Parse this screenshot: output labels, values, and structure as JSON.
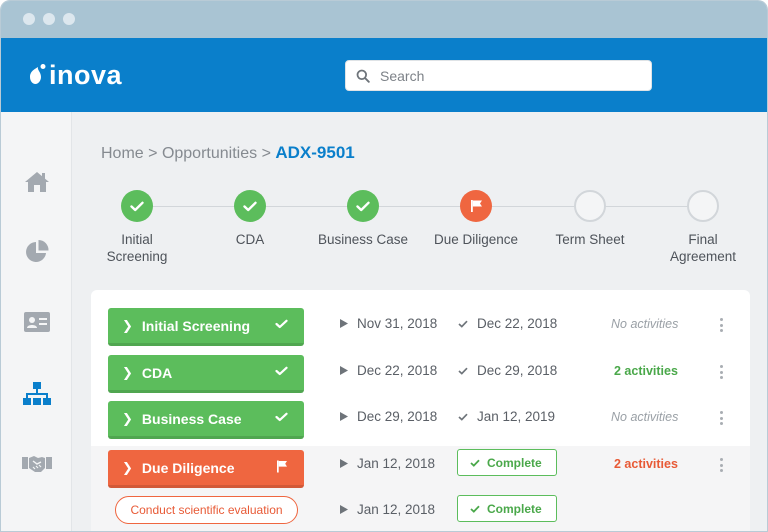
{
  "window": {
    "dots": 3
  },
  "app": {
    "logo_text": "inova"
  },
  "search": {
    "placeholder": "Search",
    "value": ""
  },
  "sidebar": {
    "items": [
      {
        "name": "home",
        "icon": "home-icon"
      },
      {
        "name": "analytics",
        "icon": "pie-chart-icon"
      },
      {
        "name": "contacts",
        "icon": "id-card-icon"
      },
      {
        "name": "organization",
        "icon": "org-chart-icon",
        "active": true
      },
      {
        "name": "partnerships",
        "icon": "handshake-icon"
      }
    ]
  },
  "breadcrumb": {
    "home": "Home",
    "sep1": ">",
    "section": "Opportunities",
    "sep2": ">",
    "current": "ADX-9501"
  },
  "steps": [
    {
      "label_line1": "Initial",
      "label_line2": "Screening",
      "state": "done"
    },
    {
      "label_line1": "CDA",
      "label_line2": "",
      "state": "done"
    },
    {
      "label_line1": "Business Case",
      "label_line2": "",
      "state": "done"
    },
    {
      "label_line1": "Due Diligence",
      "label_line2": "",
      "state": "active"
    },
    {
      "label_line1": "Term Sheet",
      "label_line2": "",
      "state": "todo"
    },
    {
      "label_line1": "Final",
      "label_line2": "Agreement",
      "state": "todo"
    }
  ],
  "phases": [
    {
      "label": "Initial Screening",
      "color": "green",
      "start": "Nov 31, 2018",
      "end": "Dec 22, 2018",
      "activities": "No activities",
      "activity_style": "none"
    },
    {
      "label": "CDA",
      "color": "green",
      "start": "Dec 22, 2018",
      "end": "Dec 29, 2018",
      "activities": "2 activities",
      "activity_style": "green"
    },
    {
      "label": "Business Case",
      "color": "green",
      "start": "Dec 29, 2018",
      "end": "Jan 12, 2019",
      "activities": "No activities",
      "activity_style": "none"
    },
    {
      "label": "Due Diligence",
      "color": "orange",
      "start": "Jan 12, 2018",
      "status": "Complete",
      "activities": "2 activities",
      "activity_style": "orange"
    }
  ],
  "task": {
    "label": "Conduct scientific evaluation",
    "start": "Jan 12, 2018",
    "status": "Complete"
  },
  "colors": {
    "primary": "#0a7fcb",
    "done": "#5cbd5c",
    "active": "#ef6640",
    "titlebar": "#a9c4d3"
  }
}
